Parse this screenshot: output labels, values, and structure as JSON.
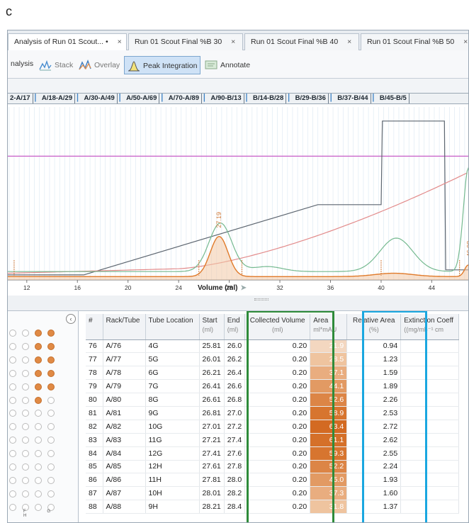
{
  "panel_letter": "c",
  "tabs": [
    {
      "label": "Analysis of Run 01 Scout... •"
    },
    {
      "label": "Run 01 Scout Final %B 30"
    },
    {
      "label": "Run 01 Scout Final %B 40"
    },
    {
      "label": "Run 01 Scout Final %B 50"
    }
  ],
  "tab_close": "×",
  "toolbar": {
    "analysis": "nalysis",
    "stack": "Stack",
    "overlay": "Overlay",
    "peak_integration": "Peak Integration",
    "annotate": "Annotate"
  },
  "fractions": [
    "2-A/17",
    "A/18-A/29",
    "A/30-A/49",
    "A/50-A/69",
    "A/70-A/89",
    "A/90-B/13",
    "B/14-B/28",
    "B/29-B/36",
    "B/37-B/44",
    "B/45-B/5"
  ],
  "chart_data": {
    "type": "line",
    "xlabel": "Volume (ml)",
    "x_ticks": [
      12,
      16,
      20,
      24,
      28,
      32,
      36,
      40,
      44
    ],
    "xlim": [
      10.5,
      47
    ],
    "peak_labels": [
      {
        "x": 27.19,
        "label": "27.19"
      },
      {
        "x": 46.98,
        "label": "46.98"
      }
    ],
    "series": [
      {
        "color": "#e07a2a",
        "style": "filled"
      },
      {
        "color": "#74b98f"
      },
      {
        "color": "#e28a8a"
      },
      {
        "color": "#5d6670"
      },
      {
        "color": "#c85fc8"
      }
    ]
  },
  "xlabel_arrow": "➤",
  "table": {
    "headers": [
      {
        "label": "#",
        "unit": ""
      },
      {
        "label": "Rack/Tube",
        "unit": ""
      },
      {
        "label": "Tube Location",
        "unit": ""
      },
      {
        "label": "Start",
        "unit": "(ml)"
      },
      {
        "label": "End",
        "unit": "(ml)"
      },
      {
        "label": "Collected Volume",
        "unit": "(ml)"
      },
      {
        "label": "Area",
        "unit": "ml*mAU"
      },
      {
        "label": "Relative Area",
        "unit": "(%)"
      },
      {
        "label": "Extinction Coeff",
        "unit": "((mg/ml)⁻¹ cm"
      }
    ],
    "rows": [
      {
        "n": "76",
        "rack": "A/76",
        "loc": "4G",
        "start": "25.81",
        "end": "26.0",
        "vol": "0.20",
        "area": "21.9",
        "rel": "0.94",
        "shade": "#f3d7c0"
      },
      {
        "n": "77",
        "rack": "A/77",
        "loc": "5G",
        "start": "26.01",
        "end": "26.2",
        "vol": "0.20",
        "area": "28.5",
        "rel": "1.23",
        "shade": "#efc49f"
      },
      {
        "n": "78",
        "rack": "A/78",
        "loc": "6G",
        "start": "26.21",
        "end": "26.4",
        "vol": "0.20",
        "area": "37.1",
        "rel": "1.59",
        "shade": "#e9ad7f"
      },
      {
        "n": "79",
        "rack": "A/79",
        "loc": "7G",
        "start": "26.41",
        "end": "26.6",
        "vol": "0.20",
        "area": "44.1",
        "rel": "1.89",
        "shade": "#e29a63"
      },
      {
        "n": "80",
        "rack": "A/80",
        "loc": "8G",
        "start": "26.61",
        "end": "26.8",
        "vol": "0.20",
        "area": "52.6",
        "rel": "2.26",
        "shade": "#dc8546"
      },
      {
        "n": "81",
        "rack": "A/81",
        "loc": "9G",
        "start": "26.81",
        "end": "27.0",
        "vol": "0.20",
        "area": "58.9",
        "rel": "2.53",
        "shade": "#d7752f"
      },
      {
        "n": "82",
        "rack": "A/82",
        "loc": "10G",
        "start": "27.01",
        "end": "27.2",
        "vol": "0.20",
        "area": "63.4",
        "rel": "2.72",
        "shade": "#d36a22"
      },
      {
        "n": "83",
        "rack": "A/83",
        "loc": "11G",
        "start": "27.21",
        "end": "27.4",
        "vol": "0.20",
        "area": "61.1",
        "rel": "2.62",
        "shade": "#d57029"
      },
      {
        "n": "84",
        "rack": "A/84",
        "loc": "12G",
        "start": "27.41",
        "end": "27.6",
        "vol": "0.20",
        "area": "59.3",
        "rel": "2.55",
        "shade": "#d7752f"
      },
      {
        "n": "85",
        "rack": "A/85",
        "loc": "12H",
        "start": "27.61",
        "end": "27.8",
        "vol": "0.20",
        "area": "52.2",
        "rel": "2.24",
        "shade": "#dc8546"
      },
      {
        "n": "86",
        "rack": "A/86",
        "loc": "11H",
        "start": "27.81",
        "end": "28.0",
        "vol": "0.20",
        "area": "45.0",
        "rel": "1.93",
        "shade": "#e29a63"
      },
      {
        "n": "87",
        "rack": "A/87",
        "loc": "10H",
        "start": "28.01",
        "end": "28.2",
        "vol": "0.20",
        "area": "37.3",
        "rel": "1.60",
        "shade": "#e9ad7f"
      },
      {
        "n": "88",
        "rack": "A/88",
        "loc": "9H",
        "start": "28.21",
        "end": "28.4",
        "vol": "0.20",
        "area": "31.8",
        "rel": "1.37",
        "shade": "#efc49f"
      }
    ]
  },
  "plate": {
    "collapse_icon": "‹",
    "col_labels": "F G H"
  }
}
